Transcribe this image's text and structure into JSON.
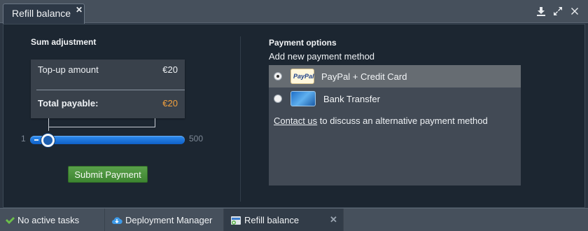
{
  "window": {
    "tab_title": "Refill balance",
    "close_symbol": "✕",
    "icons": [
      "download-icon",
      "expand-icon",
      "close-icon"
    ]
  },
  "sum_adjustment": {
    "title": "Sum adjustment",
    "topup_label": "Top-up amount",
    "topup_value": "€20",
    "total_label": "Total payable:",
    "total_value": "€20",
    "slider": {
      "min": "1",
      "max": "500",
      "value_fraction": 0.04
    },
    "submit_label": "Submit Payment"
  },
  "payment_options": {
    "title": "Payment options",
    "subtitle": "Add new payment method",
    "options": [
      {
        "label": "PayPal + Credit Card",
        "icon_text": "PayPal",
        "selected": true
      },
      {
        "label": "Bank Transfer",
        "selected": false
      }
    ],
    "note_link": "Contact us",
    "note_text": " to discuss an alternative payment method"
  },
  "taskbar": {
    "tasks": [
      {
        "label": "No active tasks",
        "icon": "check-icon"
      },
      {
        "label": "Deployment Manager",
        "icon": "cloud-icon"
      },
      {
        "label": "Refill balance",
        "icon": "refill-icon"
      }
    ],
    "close_symbol": "✕"
  },
  "colors": {
    "panel_bg": "#1c2631",
    "header_bg": "#46505c",
    "accent_orange": "#f2a03d",
    "slider_blue": "#2f8ef0",
    "submit_green": "#4a9340"
  }
}
